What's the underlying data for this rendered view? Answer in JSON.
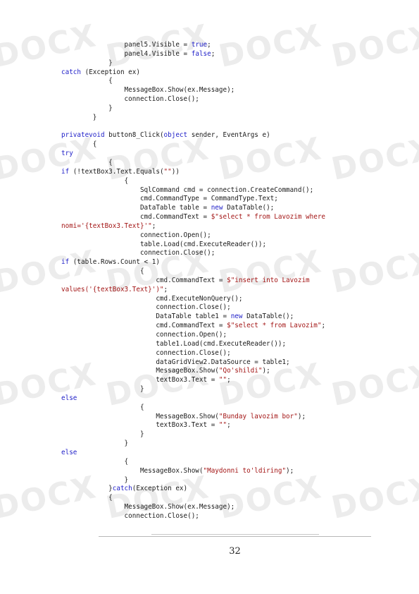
{
  "watermark": "DOCX",
  "code_lines": [
    [
      {
        "t": "                panel5.Visible = "
      },
      {
        "t": "true",
        "c": "kw"
      },
      {
        "t": ";"
      }
    ],
    [
      {
        "t": "                panel4.Visible = "
      },
      {
        "t": "false",
        "c": "kw"
      },
      {
        "t": ";"
      }
    ],
    [
      {
        "t": "            }"
      }
    ],
    [
      {
        "t": "catch",
        "c": "kw"
      },
      {
        "t": " (Exception ex)"
      }
    ],
    [
      {
        "t": "            {"
      }
    ],
    [
      {
        "t": "                MessageBox.Show(ex.Message);"
      }
    ],
    [
      {
        "t": "                connection.Close();"
      }
    ],
    [
      {
        "t": "            }"
      }
    ],
    [
      {
        "t": "        }"
      }
    ],
    [
      {
        "t": ""
      }
    ],
    [
      {
        "t": "privatevoid",
        "c": "kw"
      },
      {
        "t": " button8_Click("
      },
      {
        "t": "object",
        "c": "kw"
      },
      {
        "t": " sender, EventArgs e)"
      }
    ],
    [
      {
        "t": "        {"
      }
    ],
    [
      {
        "t": "try",
        "c": "kw"
      }
    ],
    [
      {
        "t": "            {"
      }
    ],
    [
      {
        "t": "if",
        "c": "kw"
      },
      {
        "t": " (!textBox3.Text.Equals("
      },
      {
        "t": "\"\"",
        "c": "st"
      },
      {
        "t": "))"
      }
    ],
    [
      {
        "t": "                {"
      }
    ],
    [
      {
        "t": "                    SqlCommand cmd = connection.CreateCommand();"
      }
    ],
    [
      {
        "t": "                    cmd.CommandType = CommandType.Text;"
      }
    ],
    [
      {
        "t": "                    DataTable table = "
      },
      {
        "t": "new",
        "c": "kw"
      },
      {
        "t": " DataTable();"
      }
    ],
    [
      {
        "t": "                    cmd.CommandText = "
      },
      {
        "t": "$\"select * from Lavozim where",
        "c": "st"
      }
    ],
    [
      {
        "t": "nomi='{textBox3.Text}'\"",
        "c": "st"
      },
      {
        "t": ";"
      }
    ],
    [
      {
        "t": "                    connection.Open();"
      }
    ],
    [
      {
        "t": "                    table.Load(cmd.ExecuteReader());"
      }
    ],
    [
      {
        "t": "                    connection.Close();"
      }
    ],
    [
      {
        "t": "if",
        "c": "kw"
      },
      {
        "t": " (table.Rows.Count < 1)"
      }
    ],
    [
      {
        "t": "                    {"
      }
    ],
    [
      {
        "t": "                        cmd.CommandText = "
      },
      {
        "t": "$\"insert into Lavozim",
        "c": "st"
      }
    ],
    [
      {
        "t": "values('{textBox3.Text}')\"",
        "c": "st"
      },
      {
        "t": ";"
      }
    ],
    [
      {
        "t": "                        cmd.ExecuteNonQuery();"
      }
    ],
    [
      {
        "t": "                        connection.Close();"
      }
    ],
    [
      {
        "t": "                        DataTable table1 = "
      },
      {
        "t": "new",
        "c": "kw"
      },
      {
        "t": " DataTable();"
      }
    ],
    [
      {
        "t": "                        cmd.CommandText = "
      },
      {
        "t": "$\"select * from Lavozim\"",
        "c": "st"
      },
      {
        "t": ";"
      }
    ],
    [
      {
        "t": "                        connection.Open();"
      }
    ],
    [
      {
        "t": "                        table1.Load(cmd.ExecuteReader());"
      }
    ],
    [
      {
        "t": "                        connection.Close();"
      }
    ],
    [
      {
        "t": "                        dataGridView2.DataSource = table1;"
      }
    ],
    [
      {
        "t": "                        MessageBox.Show("
      },
      {
        "t": "\"Qo'shildi\"",
        "c": "st"
      },
      {
        "t": ");"
      }
    ],
    [
      {
        "t": "                        textBox3.Text = "
      },
      {
        "t": "\"\"",
        "c": "st"
      },
      {
        "t": ";"
      }
    ],
    [
      {
        "t": "                    }"
      }
    ],
    [
      {
        "t": "else",
        "c": "kw"
      }
    ],
    [
      {
        "t": "                    {"
      }
    ],
    [
      {
        "t": "                        MessageBox.Show("
      },
      {
        "t": "\"Bunday lavozim bor\"",
        "c": "st"
      },
      {
        "t": ");"
      }
    ],
    [
      {
        "t": "                        textBox3.Text = "
      },
      {
        "t": "\"\"",
        "c": "st"
      },
      {
        "t": ";"
      }
    ],
    [
      {
        "t": "                    }"
      }
    ],
    [
      {
        "t": "                }"
      }
    ],
    [
      {
        "t": "else",
        "c": "kw"
      }
    ],
    [
      {
        "t": "                {"
      }
    ],
    [
      {
        "t": "                    MessageBox.Show("
      },
      {
        "t": "\"Maydonni to'ldiring\"",
        "c": "st"
      },
      {
        "t": ");"
      }
    ],
    [
      {
        "t": "                }"
      }
    ],
    [
      {
        "t": "            }"
      },
      {
        "t": "catch",
        "c": "kw"
      },
      {
        "t": "(Exception ex)"
      }
    ],
    [
      {
        "t": "            {"
      }
    ],
    [
      {
        "t": "                MessageBox.Show(ex.Message);"
      }
    ],
    [
      {
        "t": "                connection.Close();"
      }
    ]
  ],
  "page_number": "32"
}
